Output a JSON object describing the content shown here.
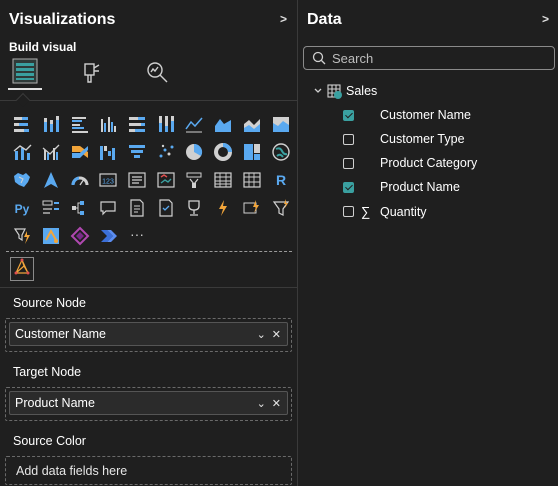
{
  "viz_pane": {
    "title": "Visualizations",
    "collapse_glyph": ">",
    "build_visual_label": "Build visual",
    "visual_icons": [
      "stacked-bar-chart",
      "stacked-column-chart",
      "clustered-bar-chart",
      "clustered-column-chart",
      "100-stacked-bar-chart",
      "100-stacked-column-chart",
      "line-chart",
      "area-chart",
      "stacked-area-chart",
      "100-stacked-area-chart",
      "line-and-stacked-column-chart",
      "line-and-clustered-column-chart",
      "ribbon-chart",
      "waterfall-chart",
      "funnel-chart",
      "scatter-chart",
      "pie-chart",
      "donut-chart",
      "treemap",
      "map",
      "filled-map",
      "azure-map",
      "gauge",
      "card",
      "multi-row-card",
      "kpi",
      "slicer",
      "table",
      "matrix",
      "r-script-visual",
      "python-visual",
      "key-influencers",
      "decomposition-tree",
      "qa-visual",
      "smart-narrative",
      "paginated-report",
      "metrics",
      "power-apps",
      "power-automate",
      "custom-visual",
      "get-more-visuals",
      "arcgis-map",
      "power-apps-diamond",
      "power-automate-chevron",
      "more-options"
    ],
    "r_label": "R",
    "py_label": "Py",
    "kpi_label": "123",
    "more_label": "···",
    "wells": [
      {
        "label": "Source Node",
        "field": "Customer Name"
      },
      {
        "label": "Target Node",
        "field": "Product Name"
      },
      {
        "label": "Source Color",
        "placeholder": "Add data fields here"
      }
    ],
    "chevron_glyph": "⌄",
    "remove_glyph": "✕"
  },
  "data_pane": {
    "title": "Data",
    "collapse_glyph": ">",
    "search_placeholder": "Search",
    "table_name": "Sales",
    "fields": [
      {
        "name": "Customer Name",
        "checked": true
      },
      {
        "name": "Customer Type",
        "checked": false
      },
      {
        "name": "Product Category",
        "checked": false
      },
      {
        "name": "Product Name",
        "checked": true
      },
      {
        "name": "Quantity",
        "checked": false,
        "sigma": "∑"
      }
    ]
  },
  "colors": {
    "background": "#1f1f1f",
    "accent_teal": "#3aa0a0",
    "icon_blue": "#5aa9f0",
    "icon_orange": "#f2a53a"
  }
}
